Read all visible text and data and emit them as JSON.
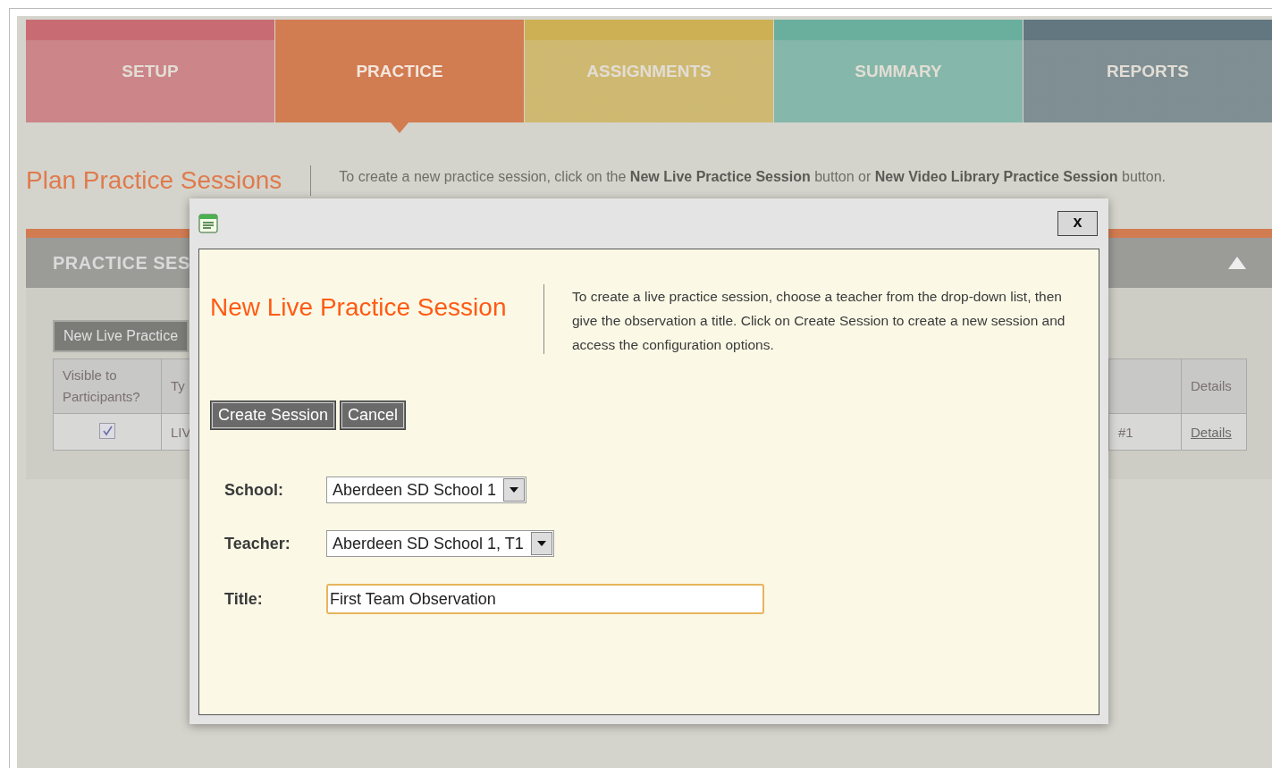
{
  "tabs": [
    {
      "label": "SETUP",
      "color": "#c96b73",
      "selected": false
    },
    {
      "label": "PRACTICE",
      "color": "#d27c52",
      "selected": true
    },
    {
      "label": "ASSIGNMENTS",
      "color": "#cdb053",
      "selected": false
    },
    {
      "label": "SUMMARY",
      "color": "#6aae9e",
      "selected": false
    },
    {
      "label": "REPORTS",
      "color": "#627780",
      "selected": false
    }
  ],
  "page": {
    "title": "Plan Practice Sessions",
    "instructions": "To create a new practice session, click on the **New Live Practice Session** button or **New Video Library Practice Session** button."
  },
  "section": {
    "title": "PRACTICE SES",
    "expanded": true,
    "button": "New Live Practice",
    "table": {
      "columns": [
        "Visible to Participants?",
        "Ty",
        "Details"
      ],
      "rows": [
        {
          "visible": true,
          "type": "LIV",
          "column_3": "#1",
          "details": "Details"
        }
      ]
    }
  },
  "dialog": {
    "close": "x",
    "title": "New Live Practice Session",
    "description": "To create a live practice session, choose a teacher from the drop-down list, then give the observation a title. Click on Create Session to create a new session and access the configuration options.",
    "buttons": [
      "Create Session",
      "Cancel"
    ],
    "fields": [
      {
        "label": "School:",
        "kind": "select",
        "value": "Aberdeen SD School 1"
      },
      {
        "label": "Teacher:",
        "kind": "select",
        "value": "Aberdeen SD School 1, T1"
      },
      {
        "label": "Title:",
        "kind": "text",
        "value": "First Team Observation",
        "focused": true
      }
    ]
  }
}
